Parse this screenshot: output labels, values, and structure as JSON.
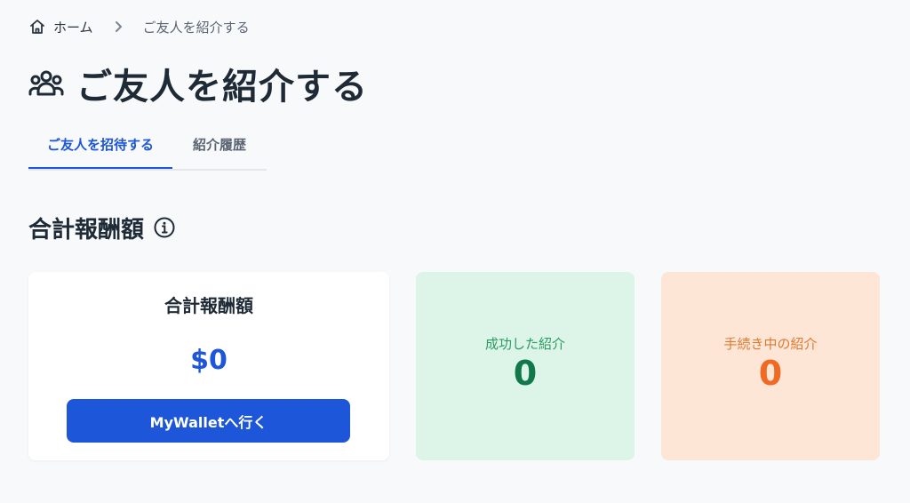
{
  "breadcrumb": {
    "home_label": "ホーム",
    "current_label": "ご友人を紹介する"
  },
  "page": {
    "title": "ご友人を紹介する"
  },
  "tabs": [
    {
      "label": "ご友人を招待する",
      "active": true
    },
    {
      "label": "紹介履歴",
      "active": false
    }
  ],
  "section": {
    "title": "合計報酬額"
  },
  "total_card": {
    "label": "合計報酬額",
    "amount": "$0",
    "button_label": "MyWalletへ行く"
  },
  "success_card": {
    "label": "成功した紹介",
    "value": "0"
  },
  "pending_card": {
    "label": "手続き中の紹介",
    "value": "0"
  },
  "icons": {
    "breadcrumb_home": "home-icon",
    "breadcrumb_separator": "chevron-right-icon",
    "title": "users-group-icon",
    "section_info": "info-icon"
  },
  "colors": {
    "accent": "#1d56d8",
    "background": "#f7f9fb",
    "success_bg": "#dcf5e8",
    "success_text": "#12784b",
    "pending_bg": "#fde6d6",
    "pending_text": "#ef6a22"
  }
}
